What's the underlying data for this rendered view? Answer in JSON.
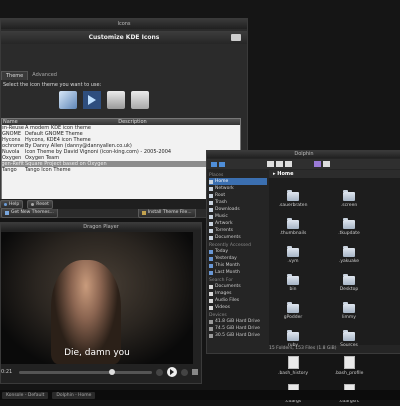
{
  "kde_icons": {
    "window_title": "Icons",
    "heading": "Customize KDE Icons",
    "tabs": [
      "Theme",
      "Advanced"
    ],
    "instruction": "Select the icon theme you want to use:",
    "columns": [
      "Name",
      "Description"
    ],
    "rows": [
      {
        "name": "eOxygen-Reuse",
        "desc": "A modern KDE icon theme"
      },
      {
        "name": "GNOME",
        "desc": "Default GNOME Theme"
      },
      {
        "name": "Hycons",
        "desc": "Hycons, KDE4 icon Theme"
      },
      {
        "name": "Monochrome",
        "desc": "By Danny Allen (danny@dannyallen.co.uk)"
      },
      {
        "name": "Nuvola",
        "desc": "Icon Theme by David Vignoni (icon-king.com) - 2005-2004"
      },
      {
        "name": "Oxygen",
        "desc": "Oxygen Team"
      },
      {
        "name": "Oxygen-Refit",
        "desc": "Square Project based on Oxygen"
      },
      {
        "name": "Tango",
        "desc": "Tango Icon Theme"
      }
    ],
    "get_new_label": "Get New Themes...",
    "install_label": "Install Theme File...",
    "help_label": "Help",
    "reset_label": "Reset"
  },
  "player": {
    "title": "Dragon Player",
    "subtitle": "Die, damn you",
    "time": "0:21"
  },
  "dolphin": {
    "title": "Dolphin",
    "breadcrumb": "Home",
    "places_header": "Places",
    "places": [
      "Home",
      "Network",
      "Root",
      "Trash",
      "Downloads",
      "Music",
      "Artwork",
      "Torrents",
      "Documents"
    ],
    "recent_header": "Recently Accessed",
    "recent": [
      "Today",
      "Yesterday",
      "This Month",
      "Last Month"
    ],
    "search_header": "Search For",
    "search": [
      "Documents",
      "Images",
      "Audio Files",
      "Videos"
    ],
    "devices_header": "Devices",
    "devices": [
      "41.8 GiB Hard Drive",
      "74.5 GiB Hard Drive",
      "30.5 GiB Hard Drive"
    ],
    "files": [
      {
        "name": ".sauerbraten",
        "type": "folder"
      },
      {
        "name": ".screen",
        "type": "folder"
      },
      {
        "name": ".thumbnails",
        "type": "folder"
      },
      {
        "name": ".tkupdate",
        "type": "folder"
      },
      {
        "name": ".vym",
        "type": "folder"
      },
      {
        "name": ".yakuake",
        "type": "folder"
      },
      {
        "name": "bin",
        "type": "folder"
      },
      {
        "name": "Desktop",
        "type": "folder"
      },
      {
        "name": "gPodder",
        "type": "folder"
      },
      {
        "name": "limmy",
        "type": "folder"
      },
      {
        "name": "ruby",
        "type": "folder"
      },
      {
        "name": "Sources",
        "type": "folder"
      },
      {
        "name": ".bash_history",
        "type": "doc"
      },
      {
        "name": ".bash_profile",
        "type": "doc"
      },
      {
        "name": ".cdargs",
        "type": "doc"
      },
      {
        "name": ".cdargsrc",
        "type": "doc"
      }
    ],
    "status": "15 Folders, 153 Files (1.8 GiB)"
  },
  "taskbar": {
    "items": [
      "Konsole - Default",
      "Dolphin - Home"
    ]
  }
}
